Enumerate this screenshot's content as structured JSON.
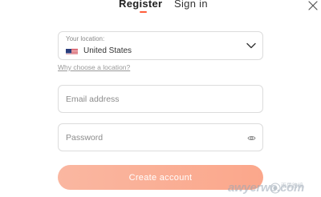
{
  "tabs": {
    "register": "Register",
    "signin": "Sign in",
    "active": "register"
  },
  "location": {
    "label": "Your location:",
    "value": "United States",
    "flag": "us-flag"
  },
  "why_link": "Why choose a location?",
  "email": {
    "placeholder": "Email address",
    "value": ""
  },
  "password": {
    "placeholder": "Password",
    "value": ""
  },
  "create_button": "Create account",
  "watermark": {
    "text": "awyerwo.com",
    "cn": "雨果跨境"
  },
  "colors": {
    "accent": "#ff5d3a",
    "button": "#fbae95",
    "border": "#dcdcdc"
  }
}
